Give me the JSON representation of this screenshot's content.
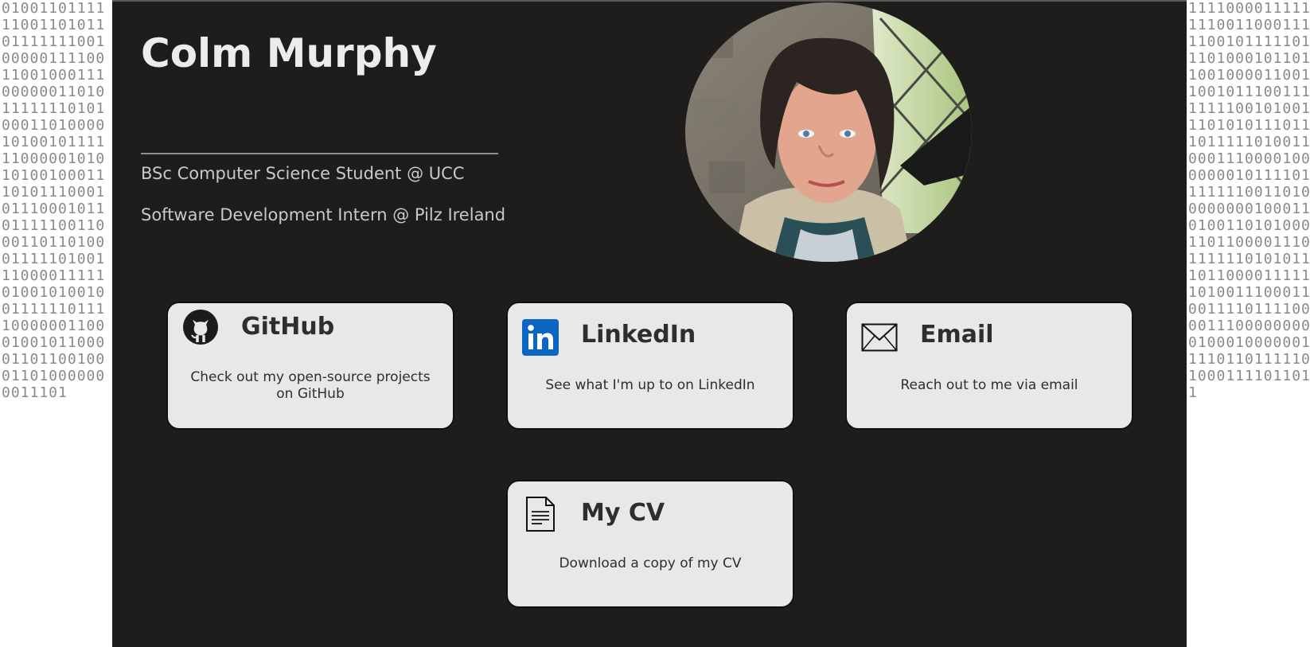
{
  "profile": {
    "name": "Colm Murphy",
    "taglines": [
      "BSc Computer Science Student @ UCC",
      "Software Development Intern @ Pilz Ireland"
    ],
    "photo_alt": "Colm Murphy"
  },
  "cards": {
    "github": {
      "icon": "github-icon",
      "title": "GitHub",
      "description": "Check out my open-source projects on GitHub"
    },
    "linkedin": {
      "icon": "linkedin-icon",
      "title": "LinkedIn",
      "description": "See what I'm up to on LinkedIn"
    },
    "email": {
      "icon": "envelope-icon",
      "title": "Email",
      "description": "Reach out to me via email"
    },
    "cv": {
      "icon": "document-icon",
      "title": "My CV",
      "description": "Download a copy of my CV"
    }
  },
  "colors": {
    "page_bg": "#1e1d1c",
    "card_bg": "#e8e8e8",
    "heading": "#ececec",
    "subtext": "#c9c9c9",
    "linkedin_blue": "#0a66c2",
    "side_pattern_digits": "#8a8a8a"
  }
}
